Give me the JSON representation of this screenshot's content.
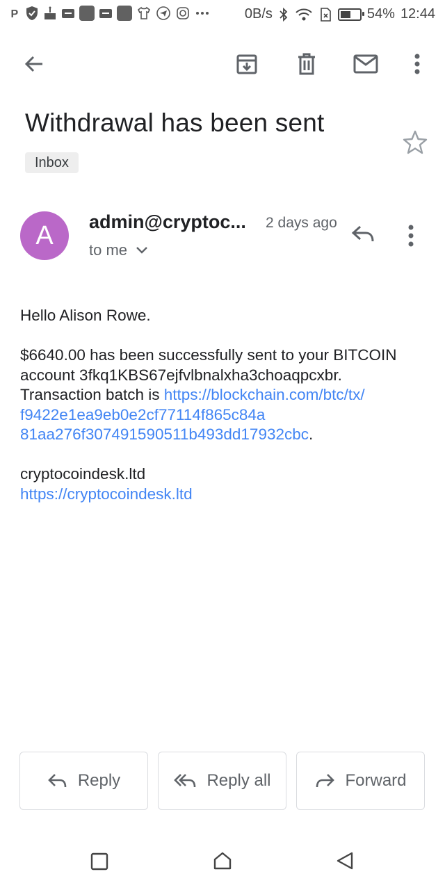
{
  "status_bar": {
    "net_speed": "0B/s",
    "battery": "54%",
    "battery_level": 0.54,
    "time": "12:44"
  },
  "toolbar": {
    "icons": [
      "arrow-back-icon",
      "archive-icon",
      "delete-icon",
      "mail-icon",
      "more-vert-icon"
    ]
  },
  "email": {
    "subject": "Withdrawal has been sent",
    "label": "Inbox",
    "avatar_letter": "A",
    "avatar_color": "#ba68c8",
    "sender": "admin@cryptoc...",
    "time": "2 days ago",
    "recipient": "to me",
    "body": {
      "greeting": "Hello Alison Rowe.",
      "line1": "$6640.00 has been successfully sent to your BITCOIN",
      "line2": "account 3fkq1KBS67ejfvlbnalxha3choaqpcxbr.",
      "line3_prefix": "Transaction batch is ",
      "tx_link_1": "https://blockchain.com/btc/tx/",
      "tx_link_2": "f9422e1ea9eb0e2cf77114f865c84a",
      "tx_link_3": "81aa276f307491590511b493dd17932cbc",
      "tx_suffix": ".",
      "signature": "cryptocoindesk.ltd",
      "signature_link": "https://cryptocoindesk.ltd"
    }
  },
  "actions": {
    "reply": "Reply",
    "reply_all": "Reply all",
    "forward": "Forward"
  },
  "colors": {
    "link": "#4285f4",
    "icon": "#5f6368"
  }
}
